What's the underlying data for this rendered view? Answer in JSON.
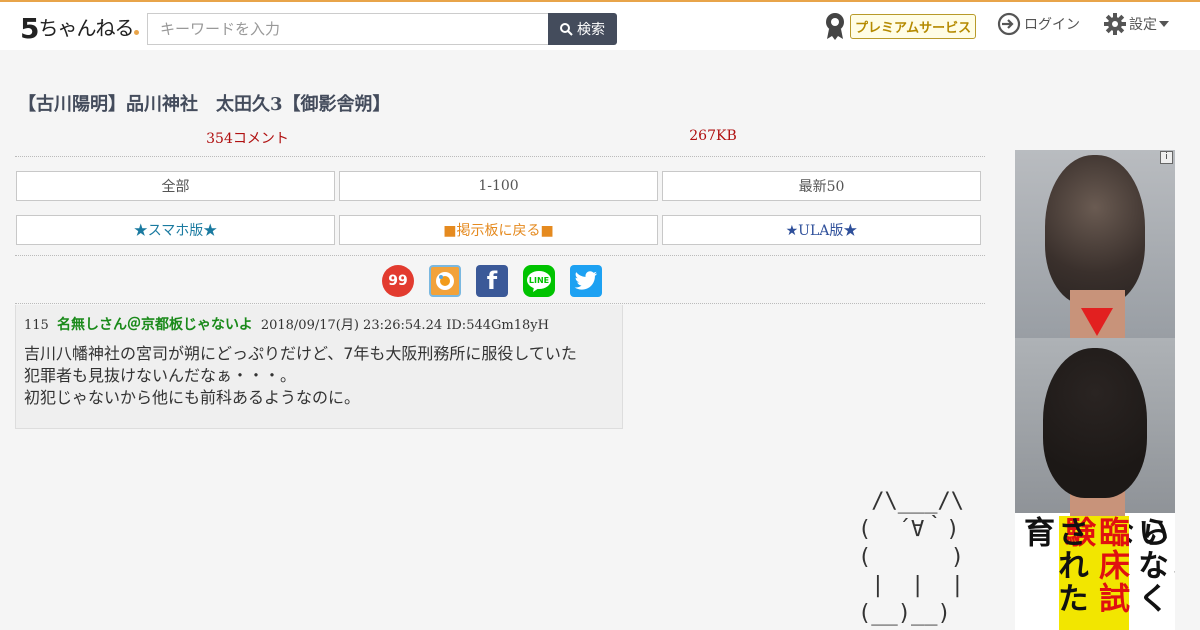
{
  "header": {
    "logo_five": "5",
    "logo_rest": "ちゃんねる",
    "search_placeholder": "キーワードを入力",
    "search_label": "検索",
    "premium_label": "プレミアムサービス",
    "login_label": "ログイン",
    "settings_label": "設定"
  },
  "thread": {
    "title": "【古川陽明】品川神社　太田久3【御影舎朔】",
    "comments": "354コメント",
    "size": "267KB"
  },
  "nav": {
    "row1": [
      "全部",
      "1-100",
      "最新50"
    ],
    "row2": [
      "★スマホ版★",
      "■掲示板に戻る■",
      "★ULA版★"
    ]
  },
  "share": {
    "icons": [
      "99-icon",
      "bookmark-icon",
      "facebook-icon",
      "line-icon",
      "twitter-icon"
    ],
    "nn_label": "99",
    "fb_label": "f",
    "line_label": "LINE"
  },
  "post": {
    "number": "115",
    "name": "名無しさん＠京都板じゃないよ",
    "date": "2018/09/17(月) 23:26:54.24",
    "id": "ID:544Gm18yH",
    "body": [
      "吉川八幡神社の宮司が朔にどっぷりだけど、7年も大阪刑務所に服役していた",
      "犯罪者も見抜けないんだなぁ・・・。",
      "初犯じゃないから他にも前科あるようなのに。"
    ]
  },
  "aa": {
    "lines": [
      " /\\___/\\",
      "(  ´∀｀)",
      "(      )",
      " |  |  |",
      "(__)__)"
    ]
  },
  "ad": {
    "info_label": "i",
    "columns": [
      "日本から",
      "いなくな",
      "臨床試験",
      "された育"
    ]
  },
  "colors": {
    "accent_orange": "#e8a44a",
    "title_color": "#444c5c",
    "meta_red": "#b01010",
    "name_green": "#1a8a1a"
  }
}
